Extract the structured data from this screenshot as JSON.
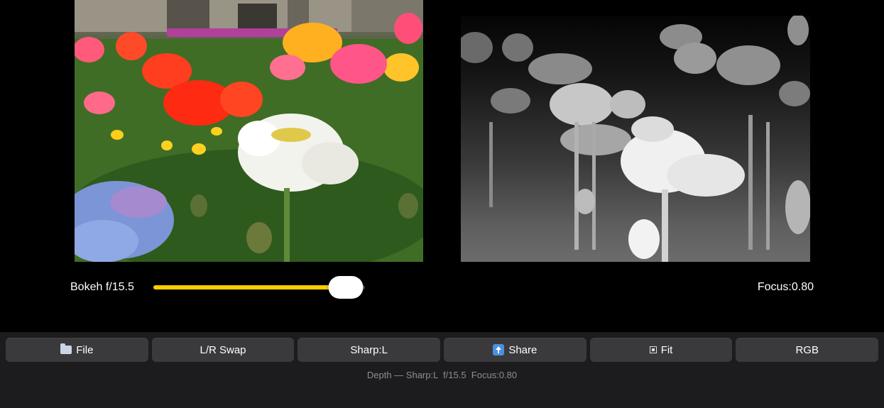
{
  "images": {
    "photo": "left-photo-poppies",
    "depth": "right-depth-map"
  },
  "controls": {
    "bokeh_label": "Bokeh f/15.5",
    "bokeh_fraction": 0.91,
    "focus_label": "Focus:0.80"
  },
  "toolbar": {
    "buttons": [
      {
        "label": "File",
        "icon": "folder-icon"
      },
      {
        "label": "L/R Swap",
        "icon": ""
      },
      {
        "label": "Sharp:L",
        "icon": ""
      },
      {
        "label": "Share",
        "icon": "share-icon"
      },
      {
        "label": "Fit",
        "icon": "fit-icon"
      },
      {
        "label": "RGB",
        "icon": ""
      }
    ],
    "status": "Depth — Sharp:L  f/15.5  Focus:0.80"
  },
  "colors": {
    "accent": "#ffcc00",
    "toolbar_bg": "#1c1c1e",
    "button_bg": "#3a3a3c",
    "status_text": "#8e8e93"
  }
}
